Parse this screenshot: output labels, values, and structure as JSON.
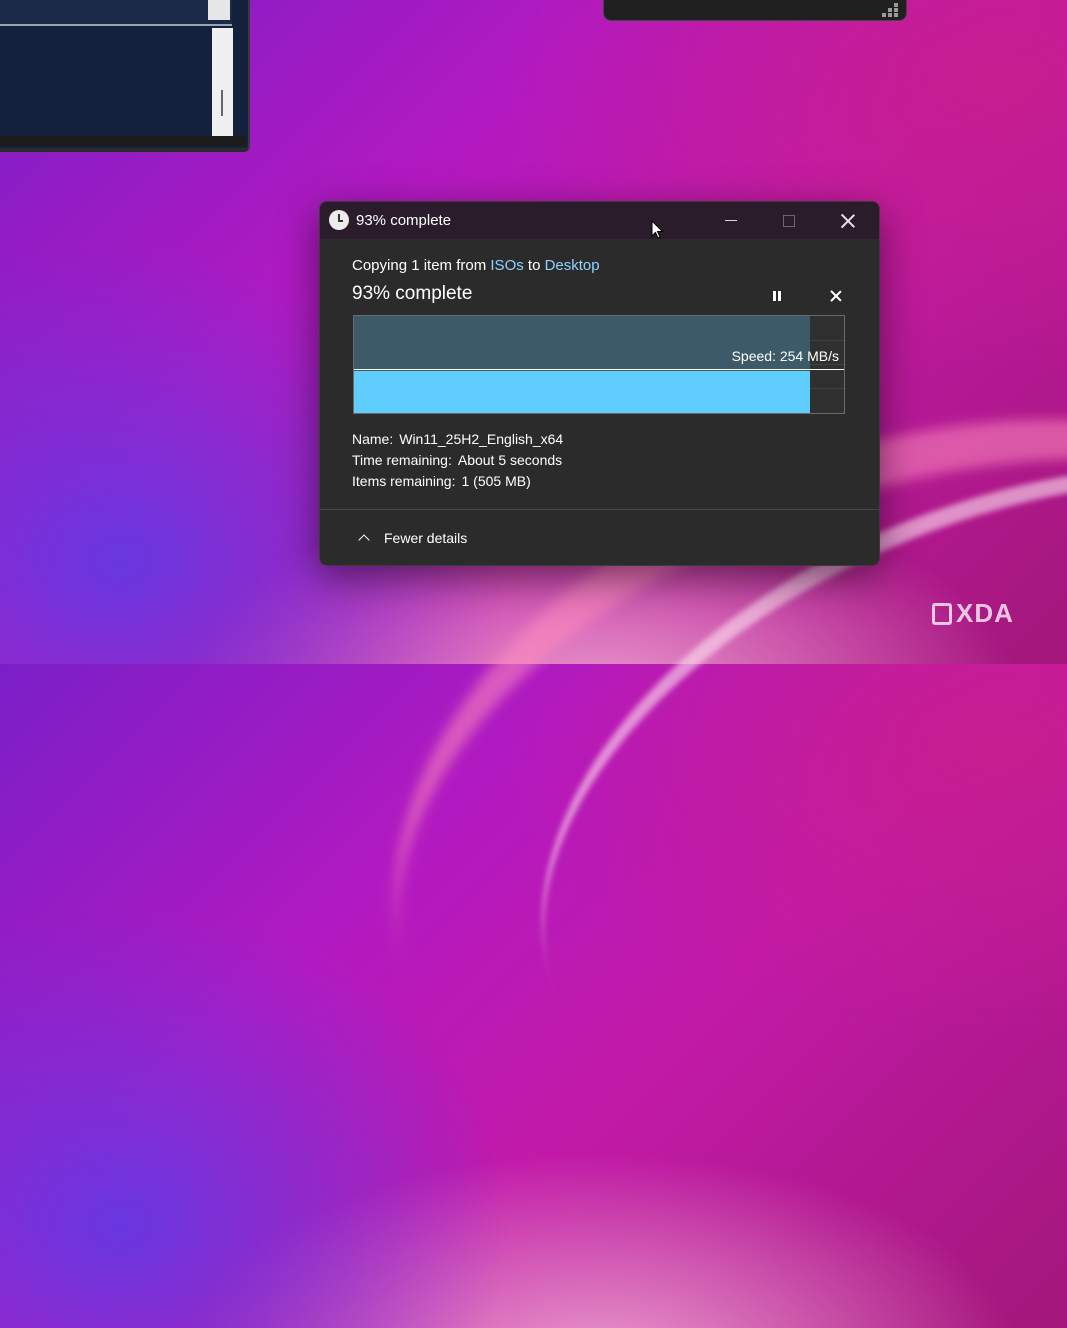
{
  "dialog": {
    "title": "93% complete",
    "copying": {
      "prefix": "Copying 1 item from ",
      "source": "ISOs",
      "middle": " to ",
      "destination": "Desktop"
    },
    "heading": "93% complete",
    "progress_percent": 93,
    "speed_label": "Speed: 254 MB/s",
    "details": {
      "name_label": "Name:",
      "name_value": "Win11_25H2_English_x64",
      "time_label": "Time remaining:",
      "time_value": "About 5 seconds",
      "items_label": "Items remaining:",
      "items_value": "1 (505 MB)"
    },
    "fewer_details_label": "Fewer details"
  },
  "watermark": {
    "text": "XDA"
  },
  "colors": {
    "accent": "#60cdff",
    "link": "#8fd3ff",
    "dialog_bg": "#2b2b2b",
    "titlebar_bg": "#2a1c2b"
  },
  "icons": [
    "clock-icon",
    "minimize-icon",
    "maximize-icon",
    "close-icon",
    "pause-icon",
    "cancel-icon",
    "chevron-up-icon",
    "mouse-cursor",
    "xda-logo"
  ]
}
